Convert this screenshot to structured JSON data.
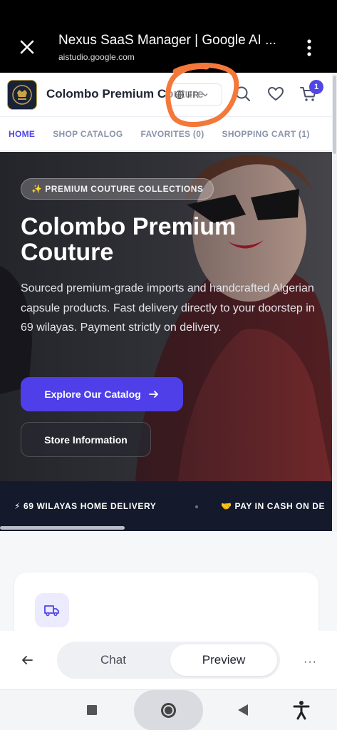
{
  "browser": {
    "title": "Nexus SaaS Manager | Google AI ...",
    "url": "aistudio.google.com"
  },
  "header": {
    "brand": "Colombo Premium Couture",
    "language": "FR",
    "cart_count": "1"
  },
  "nav": {
    "tabs": [
      {
        "label": "HOME",
        "active": true
      },
      {
        "label": "SHOP CATALOG",
        "active": false
      },
      {
        "label": "FAVORITES (0)",
        "active": false
      },
      {
        "label": "SHOPPING CART (1)",
        "active": false
      }
    ]
  },
  "hero": {
    "badge": "✨ PREMIUM COUTURE COLLECTIONS",
    "title": "Colombo Premium Couture",
    "description": "Sourced premium-grade imports and handcrafted Algerian capsule products. Fast delivery directly to your doorstep in 69 wilayas. Payment strictly on delivery.",
    "primary_button": "Explore Our Catalog",
    "secondary_button": "Store Information"
  },
  "ticker": {
    "items": [
      "⚡ 69 WILAYAS HOME DELIVERY",
      "🤝 PAY IN CASH ON DE"
    ]
  },
  "features": {
    "first_icon": "truck-icon"
  },
  "bottom": {
    "chat_label": "Chat",
    "preview_label": "Preview",
    "more_label": "···"
  },
  "colors": {
    "accent": "#4f46e5",
    "ticker_bg": "#141a2c",
    "annotation": "#f4783a"
  }
}
